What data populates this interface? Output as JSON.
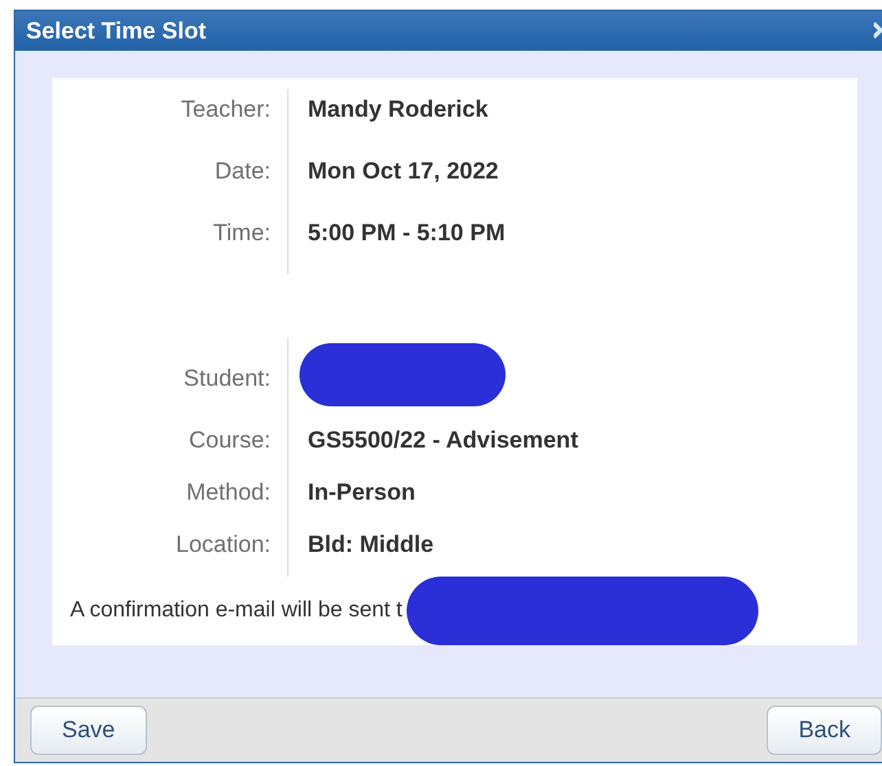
{
  "window": {
    "title": "Select Time Slot"
  },
  "groups": [
    {
      "fields": [
        {
          "label": "Teacher:",
          "value": "Mandy Roderick"
        },
        {
          "label": "Date:",
          "value": "Mon Oct 17, 2022"
        },
        {
          "label": "Time:",
          "value": "5:00 PM - 5:10 PM"
        }
      ]
    },
    {
      "fields": [
        {
          "label": "Student:",
          "redacted": true
        },
        {
          "label": "Course:",
          "value": "GS5500/22 - Advisement"
        },
        {
          "label": "Method:",
          "value": "In-Person"
        },
        {
          "label": "Location:",
          "value": "Bld: Middle"
        }
      ]
    }
  ],
  "confirmation": {
    "text": "A confirmation e-mail will be sent t",
    "redacted": true
  },
  "buttons": [
    {
      "label": "Save"
    },
    {
      "label": "Back"
    }
  ]
}
